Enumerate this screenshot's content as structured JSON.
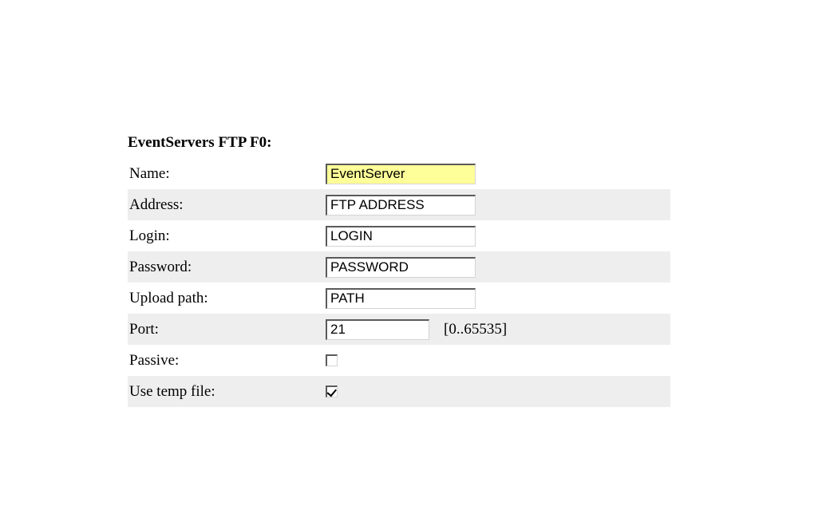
{
  "form": {
    "title": "EventServers FTP F0:",
    "rows": {
      "name": {
        "label": "Name:",
        "value": "EventServer"
      },
      "address": {
        "label": "Address:",
        "value": "FTP ADDRESS"
      },
      "login": {
        "label": "Login:",
        "value": "LOGIN"
      },
      "password": {
        "label": "Password:",
        "value": "PASSWORD"
      },
      "upload_path": {
        "label": "Upload path:",
        "value": "PATH"
      },
      "port": {
        "label": "Port:",
        "value": "21",
        "hint": "[0..65535]"
      },
      "passive": {
        "label": "Passive:",
        "checked": false
      },
      "use_temp_file": {
        "label": "Use temp file:",
        "checked": true
      }
    }
  }
}
